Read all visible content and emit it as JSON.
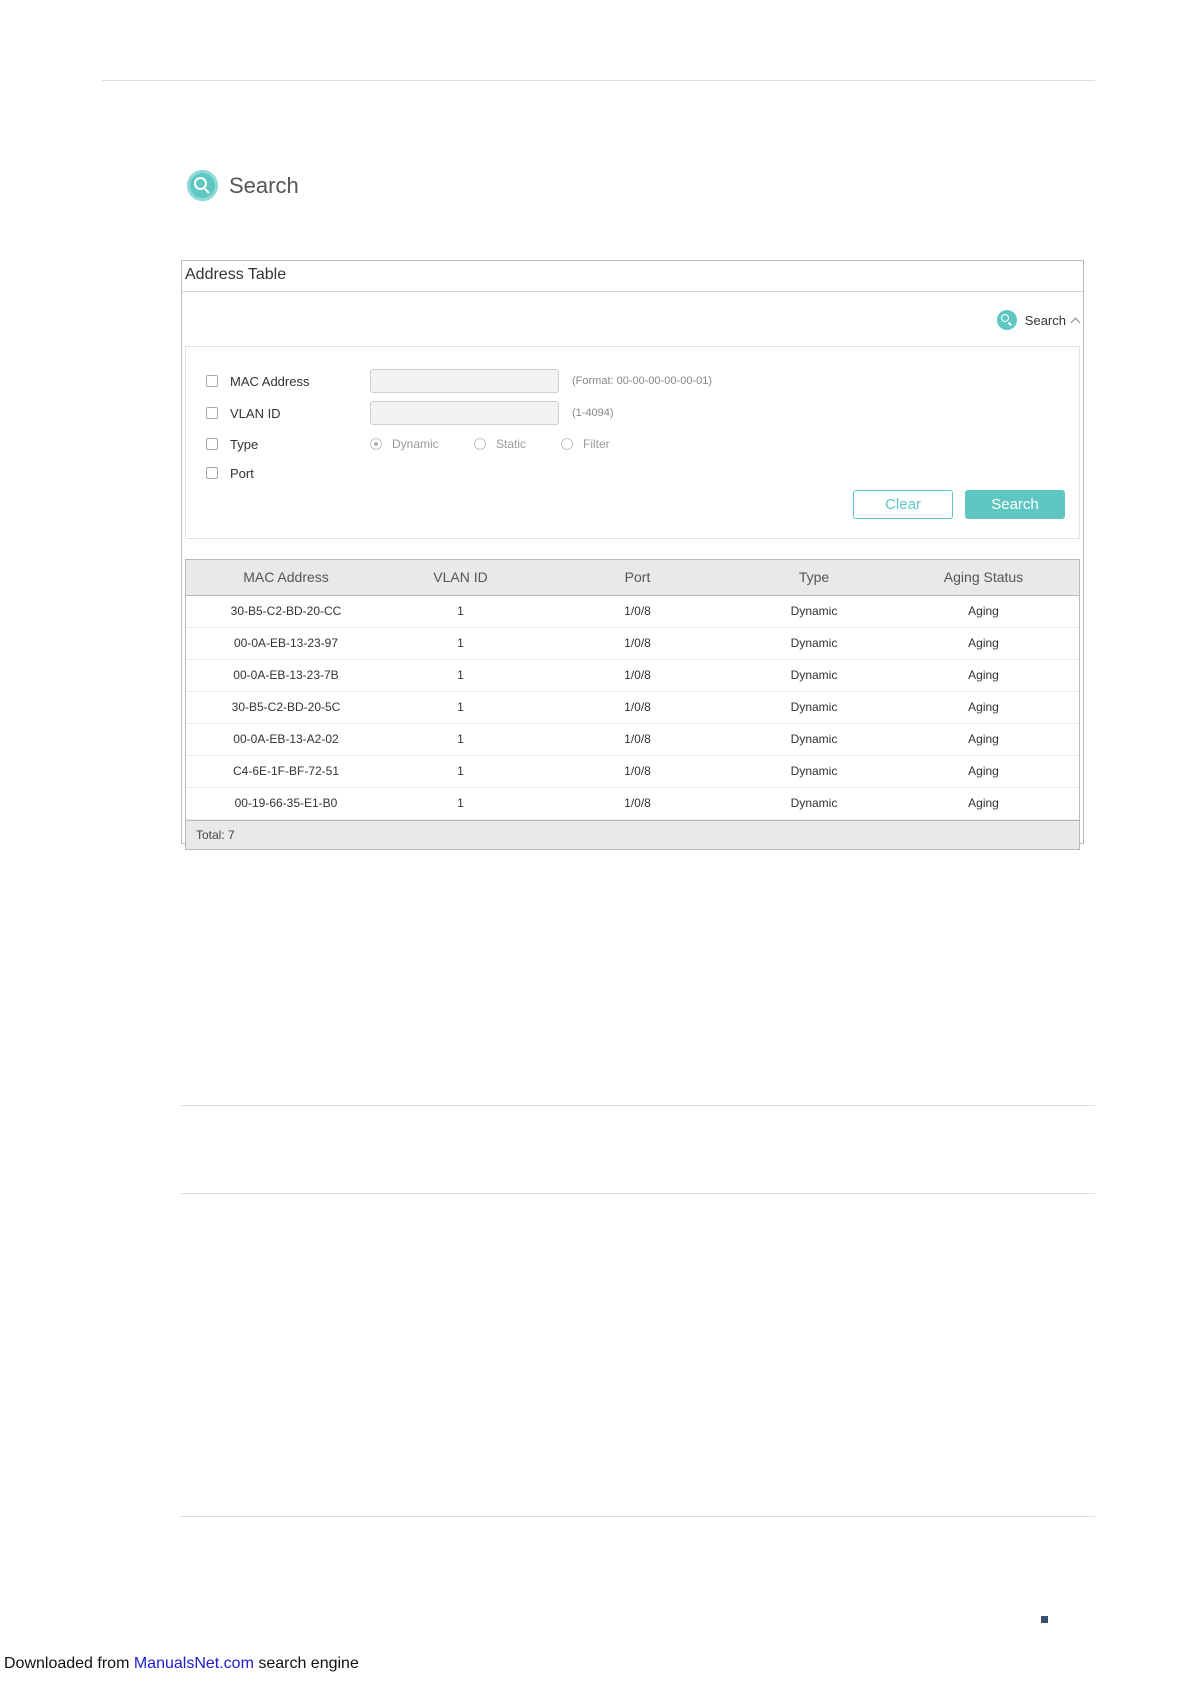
{
  "heading": {
    "label": "Search"
  },
  "panel": {
    "title": "Address Table",
    "toggle_label": "Search",
    "form": {
      "mac": {
        "label": "MAC Address",
        "value": "",
        "hint": "(Format: 00-00-00-00-00-01)"
      },
      "vlan": {
        "label": "VLAN ID",
        "value": "",
        "hint": "(1-4094)"
      },
      "type": {
        "label": "Type",
        "options": [
          "Dynamic",
          "Static",
          "Filter"
        ],
        "selected": "Dynamic"
      },
      "port": {
        "label": "Port"
      }
    },
    "buttons": {
      "clear": "Clear",
      "search": "Search"
    }
  },
  "table": {
    "columns": [
      "MAC Address",
      "VLAN ID",
      "Port",
      "Type",
      "Aging Status"
    ],
    "rows": [
      [
        "30-B5-C2-BD-20-CC",
        "1",
        "1/0/8",
        "Dynamic",
        "Aging"
      ],
      [
        "00-0A-EB-13-23-97",
        "1",
        "1/0/8",
        "Dynamic",
        "Aging"
      ],
      [
        "00-0A-EB-13-23-7B",
        "1",
        "1/0/8",
        "Dynamic",
        "Aging"
      ],
      [
        "30-B5-C2-BD-20-5C",
        "1",
        "1/0/8",
        "Dynamic",
        "Aging"
      ],
      [
        "00-0A-EB-13-A2-02",
        "1",
        "1/0/8",
        "Dynamic",
        "Aging"
      ],
      [
        "C4-6E-1F-BF-72-51",
        "1",
        "1/0/8",
        "Dynamic",
        "Aging"
      ],
      [
        "00-19-66-35-E1-B0",
        "1",
        "1/0/8",
        "Dynamic",
        "Aging"
      ]
    ],
    "total": "Total: 7"
  },
  "footer": {
    "prefix": "Downloaded from ",
    "link": "ManualsNet.com",
    "suffix": " search engine"
  },
  "colors": {
    "accent": "#5ec7c2",
    "header_bg": "#e8eaea",
    "link": "#1d1dcc"
  },
  "icons": [
    "search-icon",
    "chevron-up-icon"
  ]
}
